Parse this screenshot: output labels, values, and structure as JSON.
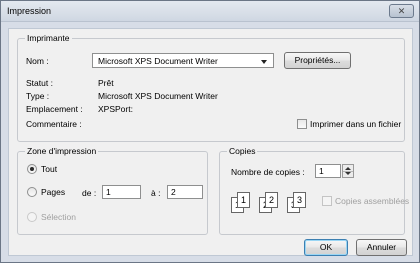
{
  "window": {
    "title": "Impression",
    "close_glyph": "✕"
  },
  "printer": {
    "legend": "Imprimante",
    "name_label": "Nom :",
    "name_value": "Microsoft XPS Document Writer",
    "properties_button": "Propriétés...",
    "status_label": "Statut :",
    "status_value": "Prêt",
    "type_label": "Type :",
    "type_value": "Microsoft XPS Document Writer",
    "location_label": "Emplacement :",
    "location_value": "XPSPort:",
    "comment_label": "Commentaire :",
    "print_to_file_label": "Imprimer dans un fichier"
  },
  "range": {
    "legend": "Zone d'impression",
    "all_label": "Tout",
    "pages_label": "Pages",
    "from_label": "de :",
    "from_value": "1",
    "to_label": "à :",
    "to_value": "2",
    "selection_label": "Sélection",
    "selected": "all"
  },
  "copies": {
    "legend": "Copies",
    "count_label": "Nombre de copies :",
    "count_value": "1",
    "collate_label": "Copies assemblées",
    "collate_checked": false,
    "collate_pages": [
      {
        "back": "1",
        "front": "1"
      },
      {
        "back": "2",
        "front": "2"
      },
      {
        "back": "3",
        "front": "3"
      }
    ]
  },
  "actions": {
    "ok_label": "OK",
    "cancel_label": "Annuler"
  }
}
